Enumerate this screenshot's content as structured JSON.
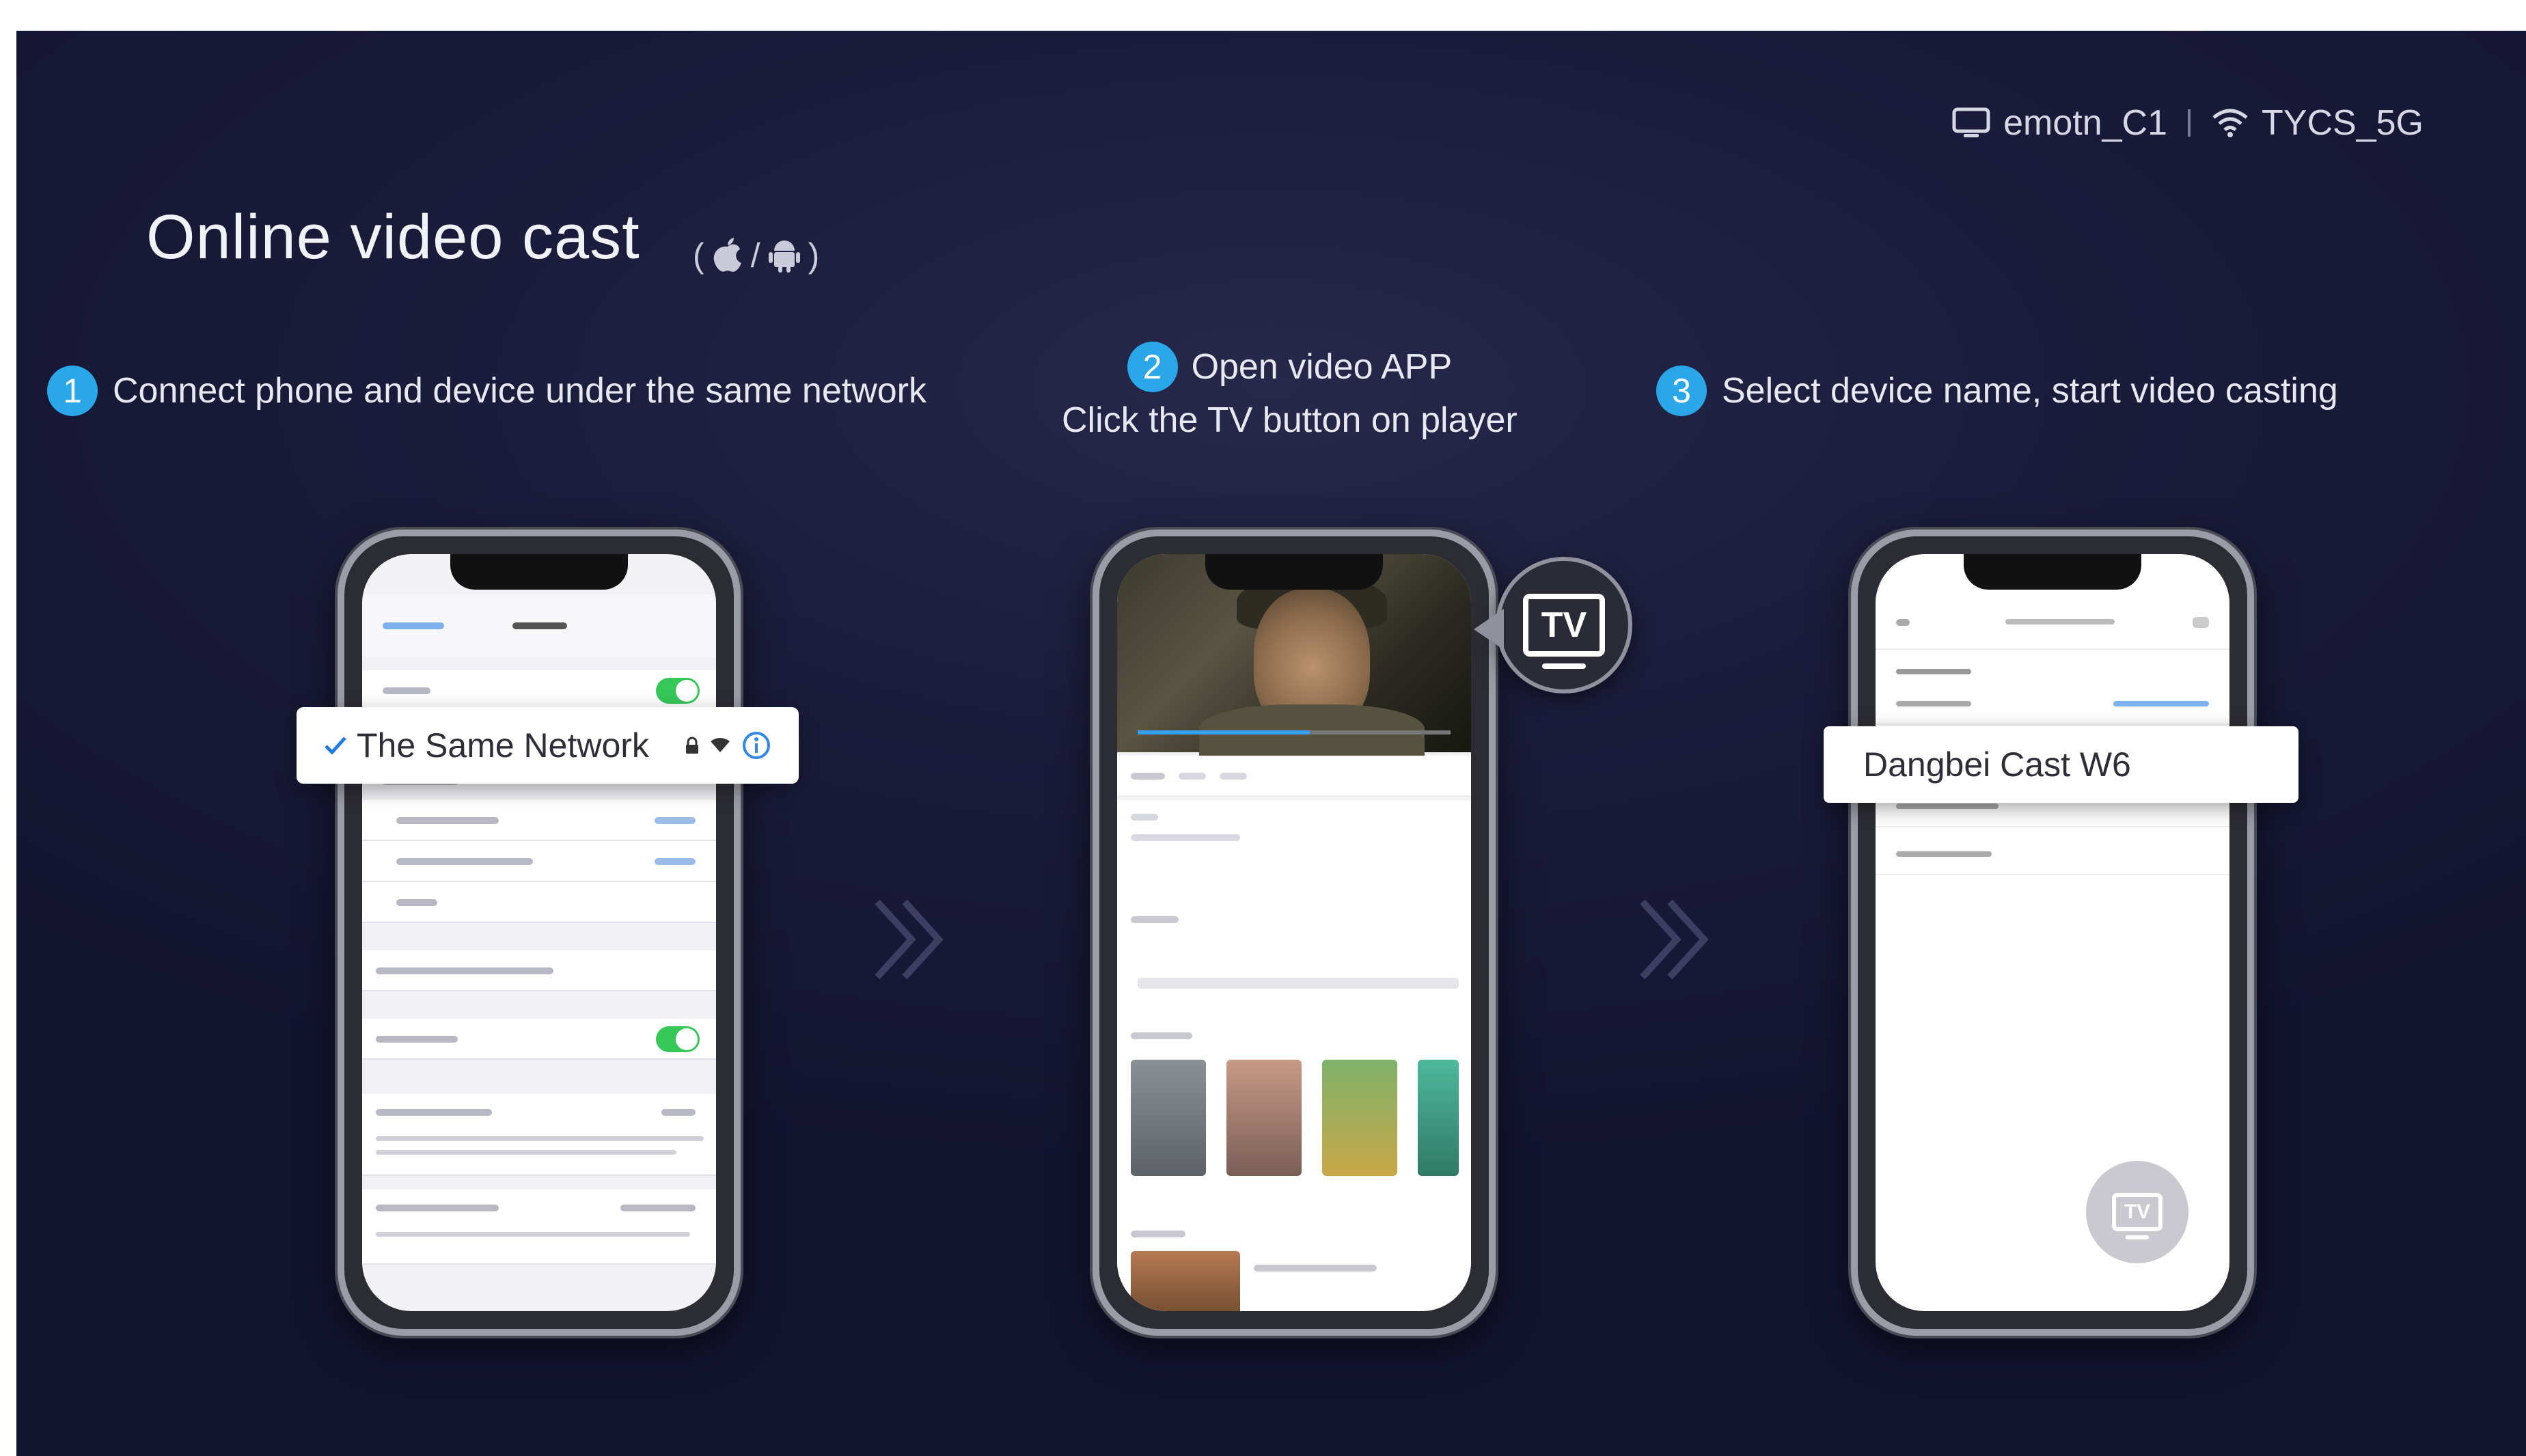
{
  "status": {
    "device_name": "emotn_C1",
    "wifi_name": "TYCS_5G"
  },
  "title": "Online video cast",
  "platforms": {
    "open": "(",
    "sep": "/",
    "close": ")"
  },
  "steps": [
    {
      "num": "1",
      "text": "Connect phone and device under the same network"
    },
    {
      "num": "2",
      "line1": "Open video APP",
      "line2": "Click the TV button on player"
    },
    {
      "num": "3",
      "text": "Select device name, start video casting"
    }
  ],
  "phone1": {
    "network_label": "The Same Network"
  },
  "phone2": {
    "tv_label": "TV"
  },
  "phone3": {
    "device_label": "Dangbei Cast W6",
    "fab_label": "TV"
  },
  "colors": {
    "accent": "#2aa7e8",
    "background": "#1b1c3b",
    "toggle": "#36c759"
  }
}
